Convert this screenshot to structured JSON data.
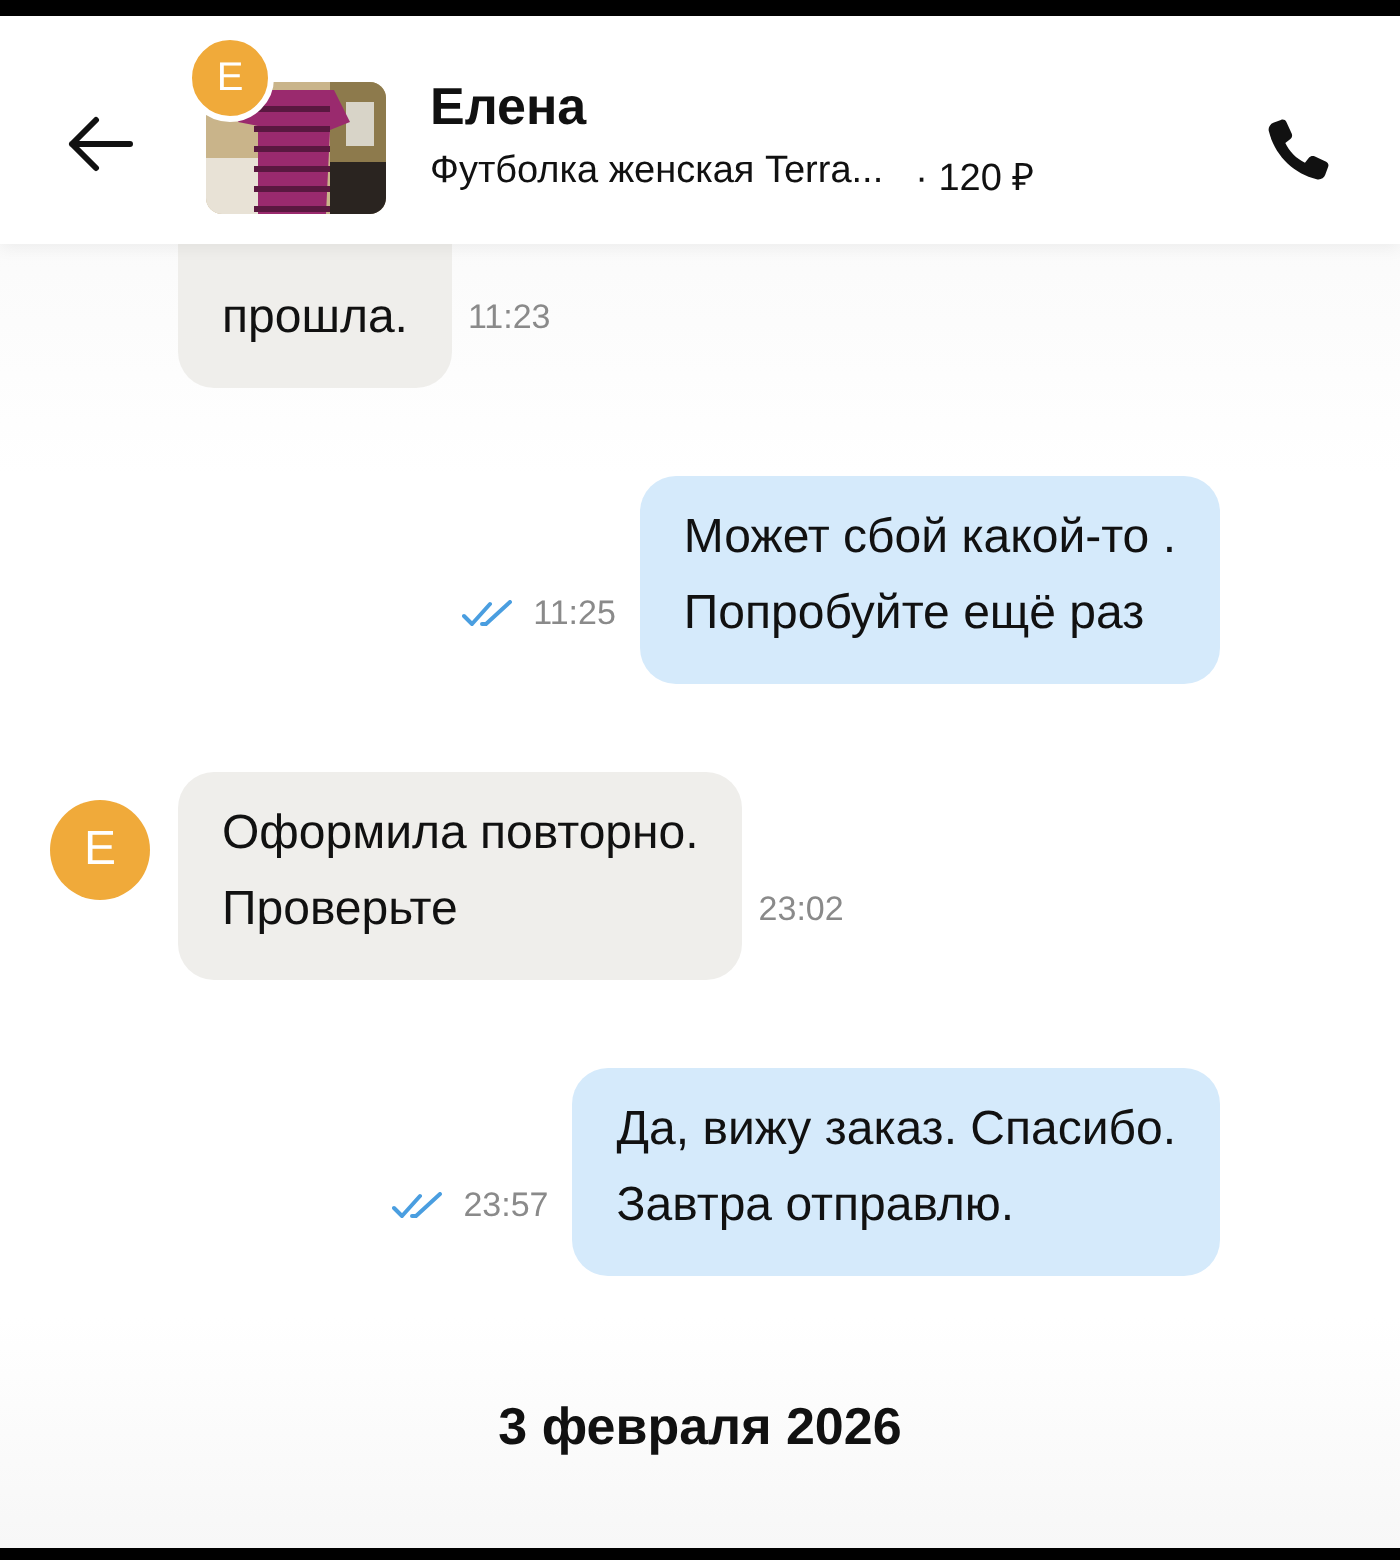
{
  "header": {
    "avatar_letter": "Е",
    "contact_name": "Елена",
    "listing_title": "Футболка женская Terra...",
    "price": "· 120 ₽"
  },
  "messages": [
    {
      "kind": "incoming",
      "text": "прошла.",
      "time": "11:23"
    },
    {
      "kind": "outgoing",
      "text": "Может сбой какой-то .\nПопробуйте ещё раз",
      "time": "11:25",
      "read": true
    },
    {
      "kind": "incoming",
      "avatar": "Е",
      "text": "Оформила повторно.\nПроверьте",
      "time": "23:02"
    },
    {
      "kind": "outgoing",
      "text": "Да, вижу заказ. Спасибо.\nЗавтра отправлю.",
      "time": "23:57",
      "read": true
    }
  ],
  "date_divider": "3 февраля 2026"
}
